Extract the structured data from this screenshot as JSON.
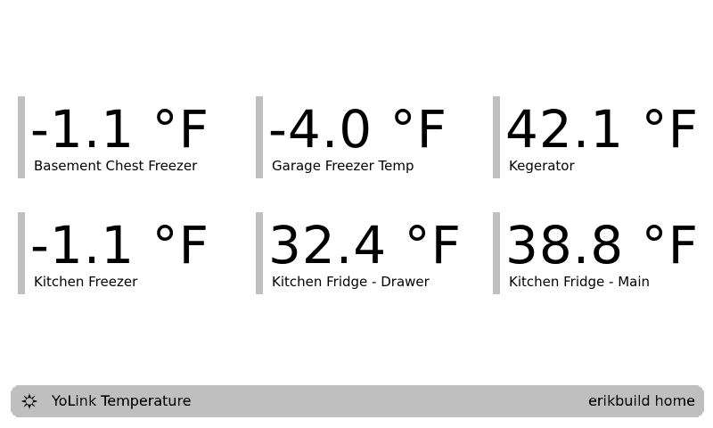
{
  "sensors": [
    {
      "value": "-1.1 °F",
      "label": "Basement Chest Freezer"
    },
    {
      "value": "-4.0 °F",
      "label": "Garage Freezer Temp"
    },
    {
      "value": "42.1 °F",
      "label": "Kegerator"
    },
    {
      "value": "-1.1 °F",
      "label": "Kitchen Freezer"
    },
    {
      "value": "32.4 °F",
      "label": "Kitchen Fridge - Drawer"
    },
    {
      "value": "38.8 °F",
      "label": "Kitchen Fridge - Main"
    }
  ],
  "footer": {
    "icon": "yolink-logo-icon",
    "title": "YoLink Temperature",
    "right_text": "erikbuild home"
  },
  "colors": {
    "background": "#ffffff",
    "foreground": "#000000"
  }
}
